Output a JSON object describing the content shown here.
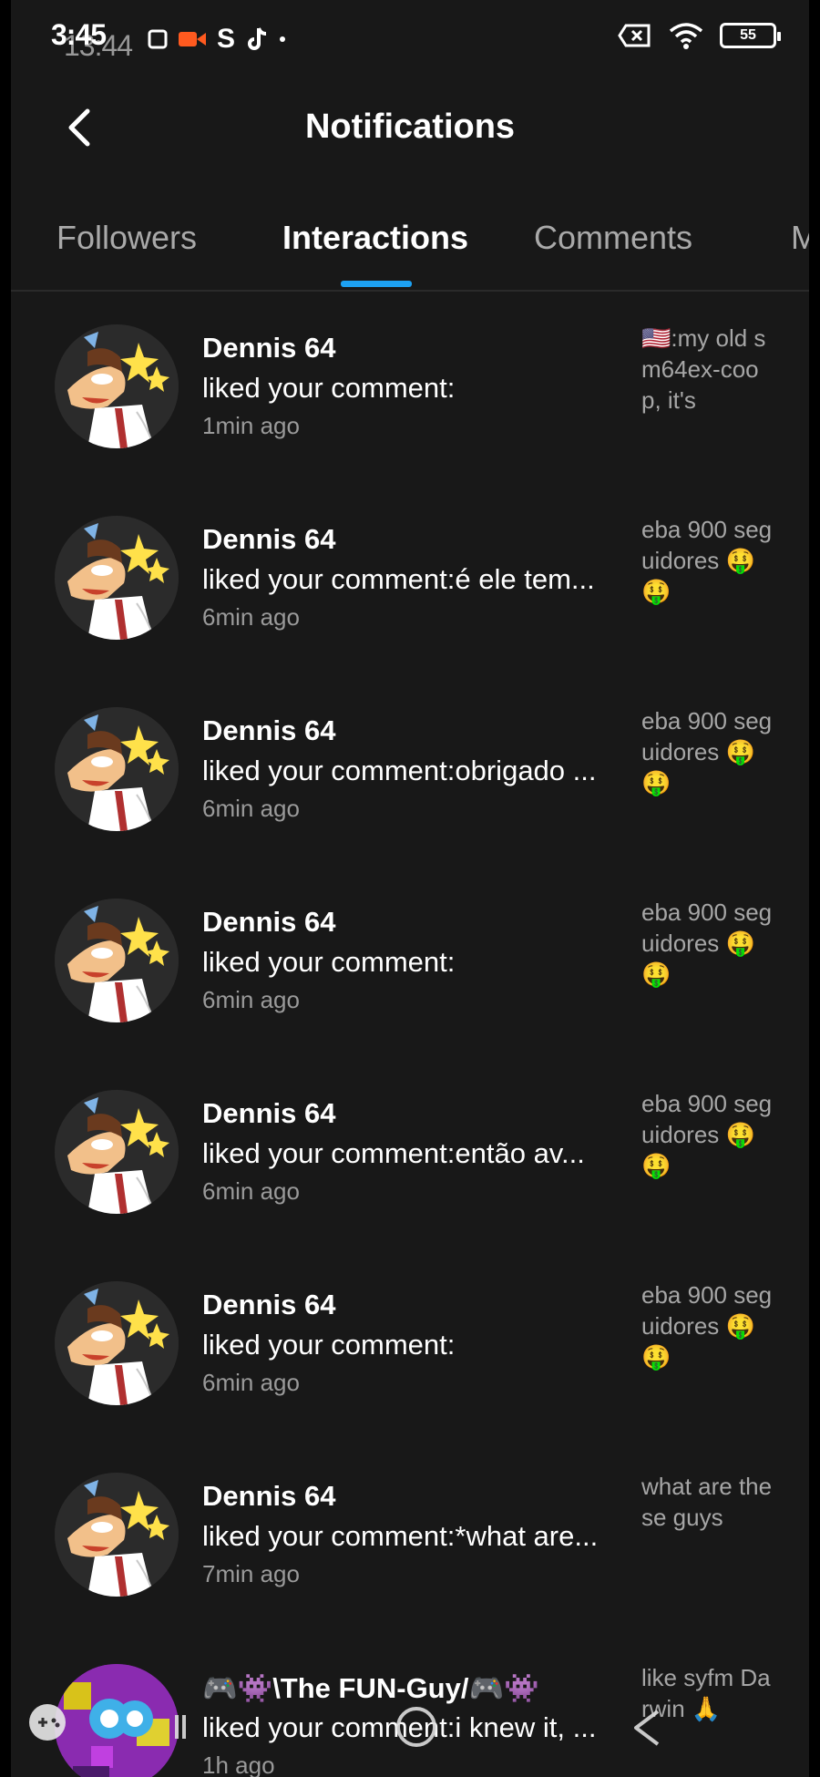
{
  "status_bar": {
    "time": "3:45",
    "time_overlay": "13:44",
    "battery": "55"
  },
  "header": {
    "title": "Notifications"
  },
  "tabs": [
    {
      "label": "Followers",
      "active": false
    },
    {
      "label": "Interactions",
      "active": true
    },
    {
      "label": "Comments",
      "active": false
    },
    {
      "label": "M",
      "active": false
    }
  ],
  "notifications": [
    {
      "user": "Dennis 64",
      "action": "liked your comment:",
      "time": "1min ago",
      "preview": "🇺🇸:my old sm64ex-coop, it's"
    },
    {
      "user": "Dennis 64",
      "action": "liked your comment:é ele tem...",
      "time": "6min ago",
      "preview": "eba 900 seguidores 🤑🤑"
    },
    {
      "user": "Dennis 64",
      "action": "liked your comment:obrigado ...",
      "time": "6min ago",
      "preview": "eba 900 seguidores 🤑🤑"
    },
    {
      "user": "Dennis 64",
      "action": "liked your comment:",
      "time": "6min ago",
      "preview": "eba 900 seguidores 🤑🤑"
    },
    {
      "user": "Dennis 64",
      "action": "liked your comment:então av...",
      "time": "6min ago",
      "preview": "eba 900 seguidores 🤑🤑"
    },
    {
      "user": "Dennis 64",
      "action": "liked your comment:",
      "time": "6min ago",
      "preview": "eba 900 seguidores 🤑🤑"
    },
    {
      "user": "Dennis 64",
      "action": "liked your comment:*what are...",
      "time": "7min ago",
      "preview": "what are these guys"
    },
    {
      "user": "🎮👾\\The FUN-Guy/🎮👾",
      "action": "liked your comment:i knew it, ...",
      "time": "1h ago",
      "preview": "like syfm Darwin 🙏"
    }
  ],
  "colors": {
    "background": "#181818",
    "accent": "#1da1f2",
    "secondary_text": "#9a9a9a"
  },
  "icons": [
    "back-arrow-icon",
    "wifi-icon",
    "battery-icon",
    "tiktok-icon",
    "gamepad-icon",
    "home-circle-icon",
    "back-triangle-icon"
  ]
}
